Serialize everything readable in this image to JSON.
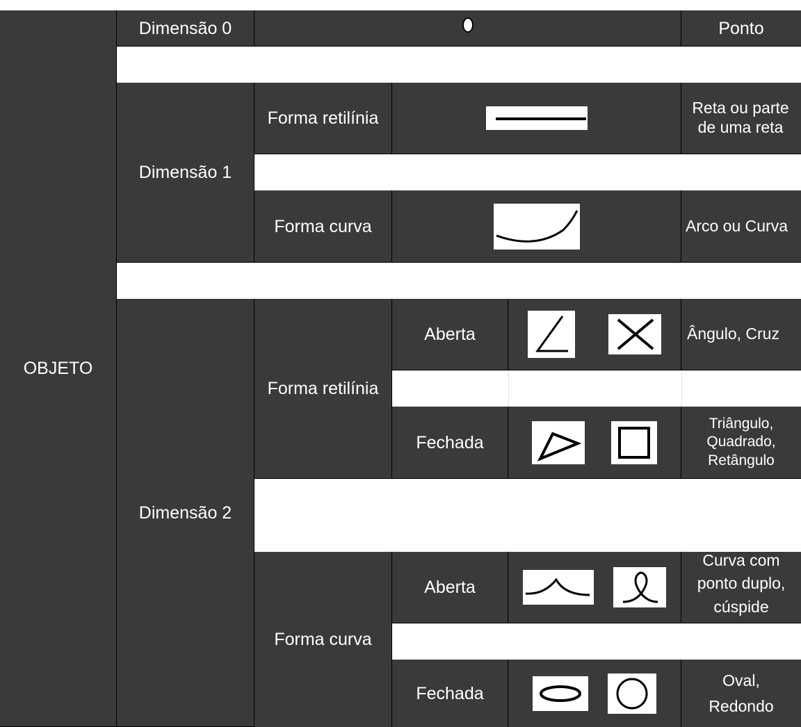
{
  "root": {
    "label": "OBJETO"
  },
  "dim0": {
    "label": "Dimensão 0",
    "icon": "point-icon",
    "description": "Ponto"
  },
  "dim1": {
    "label": "Dimensão 1",
    "rectilinear": {
      "label": "Forma retilínia",
      "icon": "line-segment-icon",
      "description": "Reta ou parte de uma reta"
    },
    "curved": {
      "label": "Forma curva",
      "icon": "arc-icon",
      "description": "Arco ou Curva"
    }
  },
  "dim2": {
    "label": "Dimensão 2",
    "rectilinear": {
      "label": "Forma retilínia",
      "open": {
        "label": "Aberta",
        "icons": [
          "angle-icon",
          "cross-icon"
        ],
        "description": "Ângulo, Cruz"
      },
      "closed": {
        "label": "Fechada",
        "icons": [
          "triangle-icon",
          "square-icon"
        ],
        "description": "Triângulo, Quadrado, Retângulo"
      }
    },
    "curved": {
      "label": "Forma curva",
      "open": {
        "label": "Aberta",
        "icons": [
          "cusp-curve-icon",
          "double-point-curve-icon"
        ],
        "description": "Curva com ponto duplo, cúspide"
      },
      "closed": {
        "label": "Fechada",
        "icons": [
          "oval-icon",
          "circle-icon"
        ],
        "description": "Oval, Redondo"
      }
    }
  },
  "colors": {
    "cell_background": "#3a3a3a",
    "text": "#ffffff",
    "gap": "#ffffff",
    "border": "#000000"
  }
}
